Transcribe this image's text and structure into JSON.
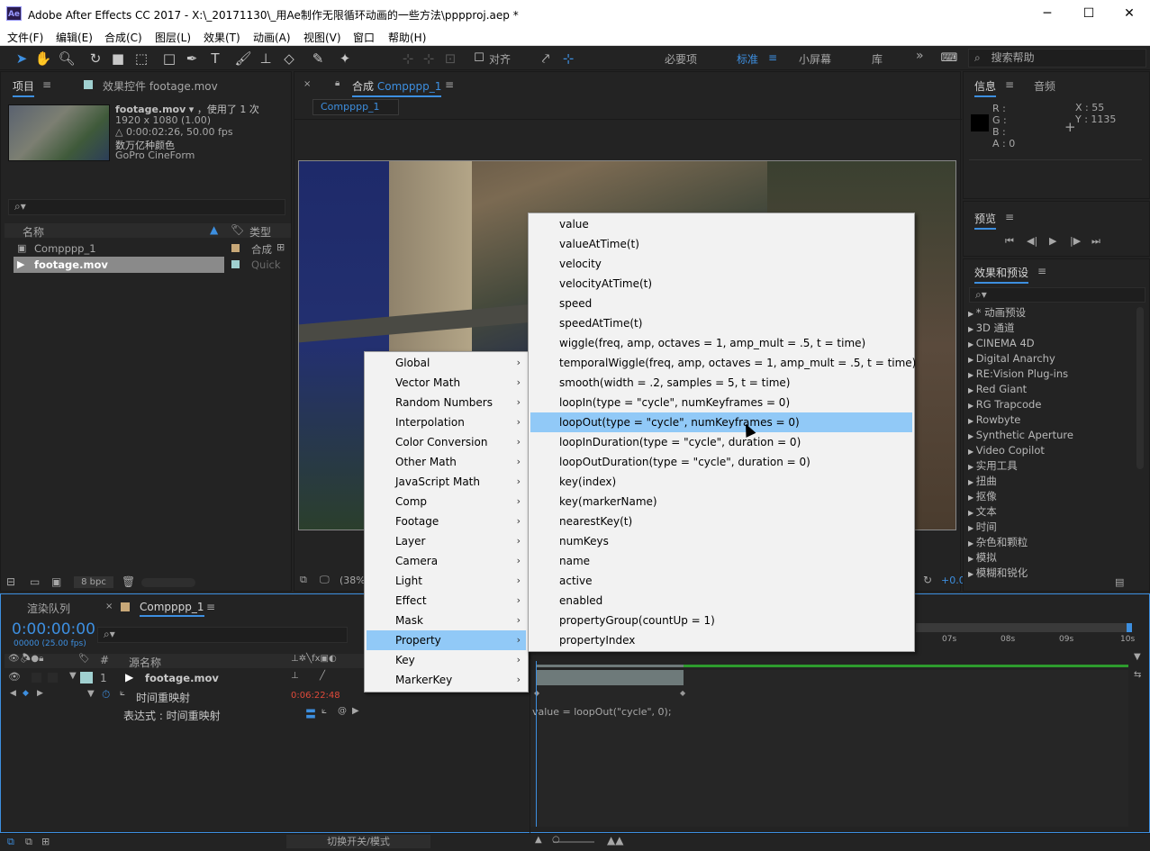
{
  "window": {
    "title": "Adobe After Effects CC 2017 - X:\\_20171130\\_用Ae制作无限循环动画的一些方法\\pppproj.aep *",
    "minimize": "─",
    "maximize": "☐",
    "close": "✕"
  },
  "menu": [
    "文件(F)",
    "编辑(E)",
    "合成(C)",
    "图层(L)",
    "效果(T)",
    "动画(A)",
    "视图(V)",
    "窗口",
    "帮助(H)"
  ],
  "toolbar": {
    "snap_label": "对齐",
    "workspaces": [
      "必要项",
      "标准",
      "小屏幕",
      "库"
    ],
    "active_workspace": "标准",
    "search_help": "搜索帮助"
  },
  "project": {
    "tab_project": "项目",
    "tab_effects": "效果控件 footage.mov",
    "footage_name": "footage.mov",
    "used_text": "，使用了 1 次",
    "resolution": "1920 x 1080 (1.00)",
    "duration": "△ 0:00:02:26, 50.00 fps",
    "colors": "数万亿种颜色",
    "codec": "GoPro CineForm",
    "col_name": "名称",
    "col_type": "类型",
    "items": [
      {
        "name": "Compppp_1",
        "type": "合成"
      },
      {
        "name": "footage.mov",
        "type": "Quick"
      }
    ],
    "bpc": "8 bpc"
  },
  "comp": {
    "tab_label": "合成",
    "tab_name": "Compppp_1",
    "sub_tab": "Compppp_1",
    "zoom": "(38%",
    "offset": "+0.0"
  },
  "info": {
    "tab_info": "信息",
    "tab_audio": "音频",
    "r": "R :",
    "g": "G :",
    "b": "B :",
    "a": "A : 0",
    "x": "X : 55",
    "y": "Y : 1135"
  },
  "preview": {
    "tab": "预览"
  },
  "effects_presets": {
    "tab": "效果和预设",
    "items": [
      "* 动画预设",
      "3D 通道",
      "CINEMA 4D",
      "Digital Anarchy",
      "RE:Vision Plug-ins",
      "Red Giant",
      "RG Trapcode",
      "Rowbyte",
      "Synthetic Aperture",
      "Video Copilot",
      "实用工具",
      "扭曲",
      "抠像",
      "文本",
      "时间",
      "杂色和颗粒",
      "模拟",
      "模糊和锐化"
    ]
  },
  "timeline": {
    "tab_render": "渲染队列",
    "tab_comp": "Compppp_1",
    "timecode": "0:00:00:00",
    "frames": "00000 (25.00 fps)",
    "col_source": "源名称",
    "layer_num": "1",
    "layer_name": "footage.mov",
    "prop_name": "时间重映射",
    "prop_value": "0:06:22:48",
    "expr_label": "表达式 : 时间重映射",
    "expr_text": "value = loopOut(\"cycle\", 0);",
    "ruler": [
      "07s",
      "08s",
      "09s",
      "10s"
    ],
    "switch_mode": "切换开关/模式"
  },
  "menu_left": {
    "items": [
      "Global",
      "Vector Math",
      "Random Numbers",
      "Interpolation",
      "Color Conversion",
      "Other Math",
      "JavaScript Math",
      "Comp",
      "Footage",
      "Layer",
      "Camera",
      "Light",
      "Effect",
      "Mask",
      "Property",
      "Key",
      "MarkerKey"
    ],
    "highlighted": "Property"
  },
  "menu_right": {
    "items": [
      "value",
      "valueAtTime(t)",
      "velocity",
      "velocityAtTime(t)",
      "speed",
      "speedAtTime(t)",
      "wiggle(freq, amp, octaves = 1, amp_mult = .5, t = time)",
      "temporalWiggle(freq, amp, octaves = 1, amp_mult = .5, t = time)",
      "smooth(width = .2, samples = 5, t = time)",
      "loopIn(type = \"cycle\", numKeyframes = 0)",
      "loopOut(type = \"cycle\", numKeyframes = 0)",
      "loopInDuration(type = \"cycle\", duration = 0)",
      "loopOutDuration(type = \"cycle\", duration = 0)",
      "key(index)",
      "key(markerName)",
      "nearestKey(t)",
      "numKeys",
      "name",
      "active",
      "enabled",
      "propertyGroup(countUp = 1)",
      "propertyIndex"
    ],
    "highlighted": "loopOut(type = \"cycle\", numKeyframes = 0)"
  },
  "colors": {
    "accent": "#3d8fe0",
    "menu_highlight": "#91c9f7",
    "panel_bg": "#232323",
    "timecode": "#3d8fe0"
  }
}
